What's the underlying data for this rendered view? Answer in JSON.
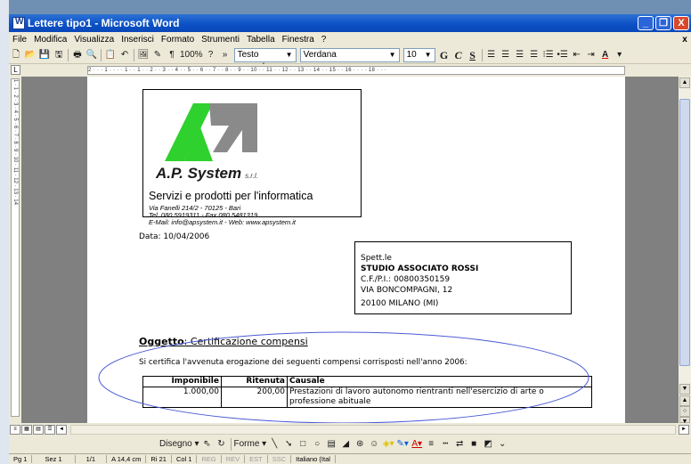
{
  "window": {
    "title": "Lettere tipo1 - Microsoft Word",
    "buttons": [
      "_",
      "❐",
      "X"
    ]
  },
  "menu": {
    "items": [
      "File",
      "Modifica",
      "Visualizza",
      "Inserisci",
      "Formato",
      "Strumenti",
      "Tabella",
      "Finestra",
      "?"
    ],
    "close": "x"
  },
  "toolbar": {
    "zoom": "100%",
    "style": "Testo normale",
    "font": "Verdana",
    "size": "10",
    "bold": "G",
    "italic": "C",
    "underline": "S"
  },
  "ruler": {
    "marks": "2 · · · 1 · · · · 1 · · 1 · · 2 · · 3 · · 4 · · 5 · · 6 · · 7 · · 8 · · 9 · · 10 · · 11 · · 12 · · 13 · · 14 · · 15 · · 16 · · · · 18 · · ·",
    "vmarks": "1 · 1 · 2 · 3 · 4 · 5 · 6 · 7 · 8 · 9 · 10 · 11 · 12 · 13 · 14",
    "corner": "L"
  },
  "letterhead": {
    "brand": "A.P. System",
    "srl": "s.r.l.",
    "tagline": "Servizi e prodotti per l'informatica",
    "address": "Via Fanelli 214/2 - 70125 - Bari",
    "phone": "Tel. 080 5919311 - Fax 080 5481319",
    "email": "E-Mail: info@apsystem.it - Web: www.apsystem.it"
  },
  "date": "Data: 10/04/2006",
  "recipient": {
    "salutation": "Spett.le",
    "name": "STUDIO ASSOCIATO ROSSI",
    "vat": "C.F./P.I.: 00800350159",
    "street": "VIA BONCOMPAGNI, 12",
    "city": "20100 MILANO (MI)"
  },
  "subject": {
    "label": "Oggetto",
    "text": ": Certificazione compensi"
  },
  "intro": "Si certifica l'avvenuta erogazione dei seguenti compensi corrisposti nell'anno 2006:",
  "table": {
    "headers": [
      "Imponibile",
      "Ritenuta",
      "Causale"
    ],
    "rows": [
      [
        "1.000,00",
        "200,00",
        "Prestazioni di lavoro autonomo rientranti nell'esercizio di arte o professione abituale"
      ]
    ]
  },
  "drawing": {
    "disegno": "Disegno ▾",
    "forme": "Forme ▾"
  },
  "status": {
    "page": "Pg 1",
    "section": "Sez 1",
    "pages": "1/1",
    "position": "A 14,4 cm",
    "row": "Ri 21",
    "col": "Col 1",
    "reg": "REG",
    "rev": "REV",
    "est": "EST",
    "ssc": "SSC",
    "lang": "Italiano (Ital"
  },
  "colors": {
    "title_gradient": "#0a4fc4",
    "logo_green": "#2fd12f",
    "logo_gray": "#8a8a8a",
    "ellipse": "#4a5bd4"
  }
}
